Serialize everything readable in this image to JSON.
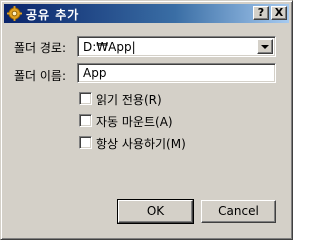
{
  "window": {
    "title": "공유 추가",
    "title_icon": "gear-icon",
    "help_label": "?",
    "close_label": "X"
  },
  "form": {
    "folder_path_label": "폴더 경로:",
    "folder_path_value": "D:₩App|",
    "folder_name_label": "폴더 이름:",
    "folder_name_value": "App"
  },
  "options": [
    {
      "label": "읽기 전용(R)",
      "checked": false
    },
    {
      "label": "자동 마운트(A)",
      "checked": false
    },
    {
      "label": "항상 사용하기(M)",
      "checked": false
    }
  ],
  "buttons": {
    "ok": "OK",
    "cancel": "Cancel"
  },
  "colors": {
    "title_gradient_start": "#0a246a",
    "title_gradient_end": "#a6caf0",
    "face": "#d4d0c8"
  }
}
